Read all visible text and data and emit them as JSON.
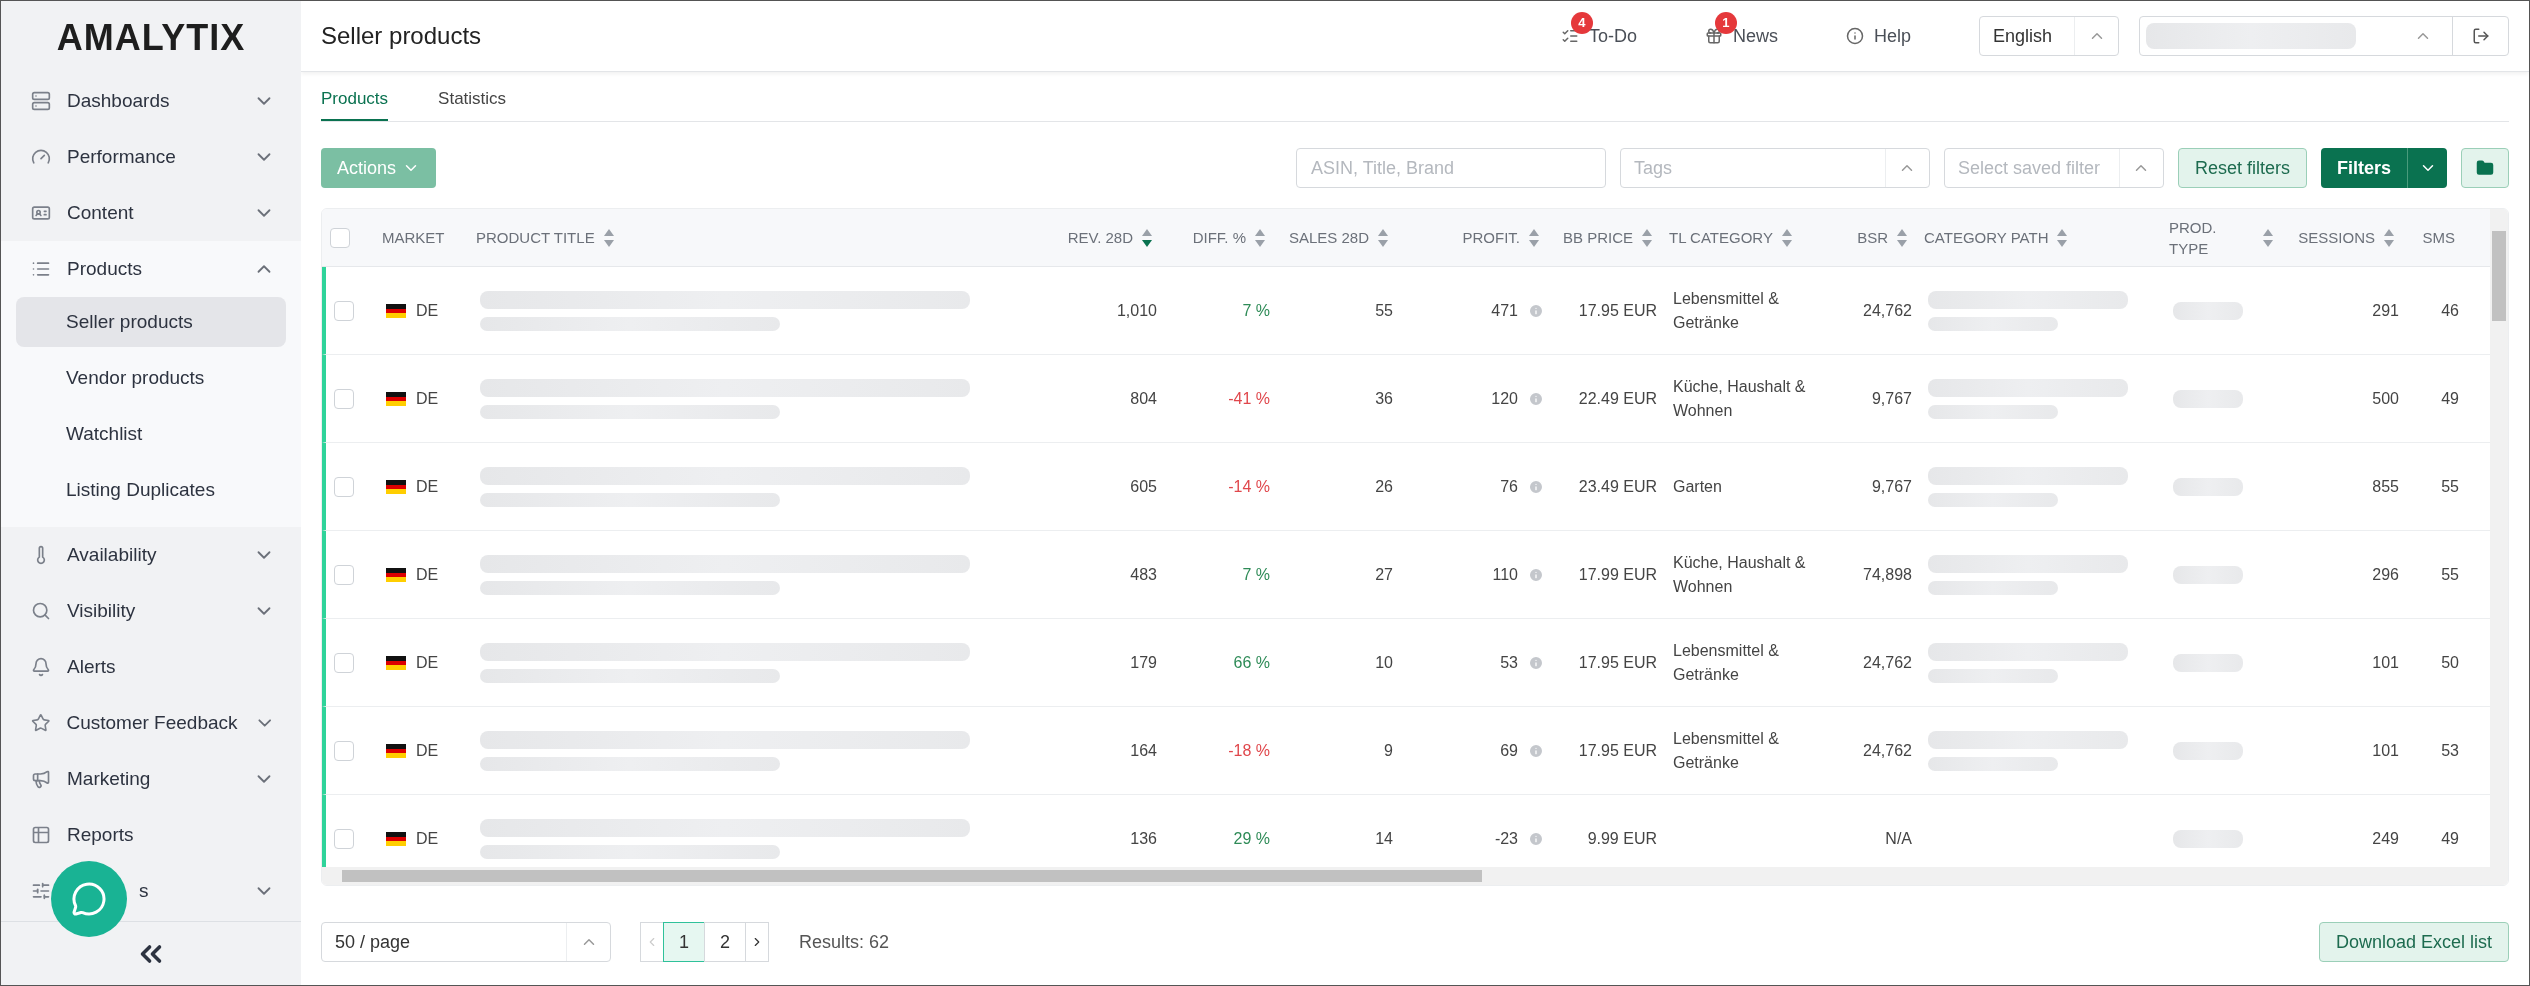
{
  "sidebar": {
    "logo": "AMALYTIX",
    "items": [
      {
        "label": "Dashboards",
        "expandable": true,
        "expanded": false
      },
      {
        "label": "Performance",
        "expandable": true,
        "expanded": false
      },
      {
        "label": "Content",
        "expandable": true,
        "expanded": false
      },
      {
        "label": "Products",
        "expandable": true,
        "expanded": true,
        "children": [
          {
            "label": "Seller products",
            "selected": true
          },
          {
            "label": "Vendor products",
            "selected": false
          },
          {
            "label": "Watchlist",
            "selected": false
          },
          {
            "label": "Listing Duplicates",
            "selected": false
          }
        ]
      },
      {
        "label": "Availability",
        "expandable": true,
        "expanded": false
      },
      {
        "label": "Visibility",
        "expandable": true,
        "expanded": false
      },
      {
        "label": "Alerts",
        "expandable": false
      },
      {
        "label": "Customer Feedback",
        "expandable": true,
        "expanded": false
      },
      {
        "label": "Marketing",
        "expandable": true,
        "expanded": false
      },
      {
        "label": "Reports",
        "expandable": false
      },
      {
        "label": "s",
        "expandable": true,
        "expanded": false
      }
    ]
  },
  "header": {
    "title": "Seller products",
    "links": [
      {
        "label": "To-Do",
        "badge": "4"
      },
      {
        "label": "News",
        "badge": "1"
      },
      {
        "label": "Help"
      }
    ],
    "language": "English"
  },
  "tabs": [
    {
      "label": "Products",
      "selected": true
    },
    {
      "label": "Statistics",
      "selected": false
    }
  ],
  "toolbar": {
    "actions": "Actions",
    "search_placeholder": "ASIN, Title, Brand",
    "tags_placeholder": "Tags",
    "saved_filter_placeholder": "Select saved filter",
    "reset": "Reset filters",
    "filters": "Filters"
  },
  "select_all": {
    "checked": false
  },
  "columns": [
    {
      "label": "MARKET",
      "sortable": false
    },
    {
      "label": "PRODUCT TITLE",
      "sortable": true,
      "sorted": false
    },
    {
      "label": "REV. 28D",
      "sortable": true,
      "sorted": true
    },
    {
      "label": "DIFF. %",
      "sortable": true,
      "sorted": false
    },
    {
      "label": "SALES 28D",
      "sortable": true,
      "sorted": false
    },
    {
      "label": "PROFIT.",
      "sortable": true,
      "sorted": false
    },
    {
      "label": "BB PRICE",
      "sortable": true,
      "sorted": false
    },
    {
      "label": "TL CATEGORY",
      "sortable": true,
      "sorted": false
    },
    {
      "label": "BSR",
      "sortable": true,
      "sorted": false
    },
    {
      "label": "CATEGORY PATH",
      "sortable": true,
      "sorted": false
    },
    {
      "label": "PROD. TYPE",
      "sortable": true,
      "sorted": false
    },
    {
      "label": "SESSIONS",
      "sortable": true,
      "sorted": false
    },
    {
      "label": "SMS",
      "sortable": false
    }
  ],
  "rows": [
    {
      "checked": false,
      "market": "DE",
      "revenue": "1,010",
      "diff": "7 %",
      "positive": true,
      "sales": "55",
      "profit": "471",
      "bb_price": "17.95 EUR",
      "tl_category": "Lebensmittel & Getränke",
      "bsr": "24,762",
      "path_blurred": true,
      "sessions": "291",
      "sms": "46"
    },
    {
      "checked": false,
      "market": "DE",
      "revenue": "804",
      "diff": "-41 %",
      "positive": false,
      "sales": "36",
      "profit": "120",
      "bb_price": "22.49 EUR",
      "tl_category": "Küche, Haushalt & Wohnen",
      "bsr": "9,767",
      "path_blurred": true,
      "sessions": "500",
      "sms": "49"
    },
    {
      "checked": false,
      "market": "DE",
      "revenue": "605",
      "diff": "-14 %",
      "positive": false,
      "sales": "26",
      "profit": "76",
      "bb_price": "23.49 EUR",
      "tl_category": "Garten",
      "bsr": "9,767",
      "path_blurred": true,
      "sessions": "855",
      "sms": "55"
    },
    {
      "checked": false,
      "market": "DE",
      "revenue": "483",
      "diff": "7 %",
      "positive": true,
      "sales": "27",
      "profit": "110",
      "bb_price": "17.99 EUR",
      "tl_category": "Küche, Haushalt & Wohnen",
      "bsr": "74,898",
      "path_blurred": true,
      "sessions": "296",
      "sms": "55"
    },
    {
      "checked": false,
      "market": "DE",
      "revenue": "179",
      "diff": "66 %",
      "positive": true,
      "sales": "10",
      "profit": "53",
      "bb_price": "17.95 EUR",
      "tl_category": "Lebensmittel & Getränke",
      "bsr": "24,762",
      "path_blurred": true,
      "sessions": "101",
      "sms": "50"
    },
    {
      "checked": false,
      "market": "DE",
      "revenue": "164",
      "diff": "-18 %",
      "positive": false,
      "sales": "9",
      "profit": "69",
      "bb_price": "17.95 EUR",
      "tl_category": "Lebensmittel & Getränke",
      "bsr": "24,762",
      "path_blurred": true,
      "sessions": "101",
      "sms": "53"
    },
    {
      "checked": false,
      "market": "DE",
      "revenue": "136",
      "diff": "29 %",
      "positive": true,
      "sales": "14",
      "profit": "-23",
      "bb_price": "9.99 EUR",
      "bsr": "N/A",
      "path_blurred": false,
      "sessions": "249",
      "sms": "49"
    }
  ],
  "footer": {
    "page_size": "50 / page",
    "pages": [
      {
        "label": "1",
        "selected": true
      },
      {
        "label": "2",
        "selected": false
      }
    ],
    "results": "Results: 62",
    "download": "Download Excel list"
  }
}
